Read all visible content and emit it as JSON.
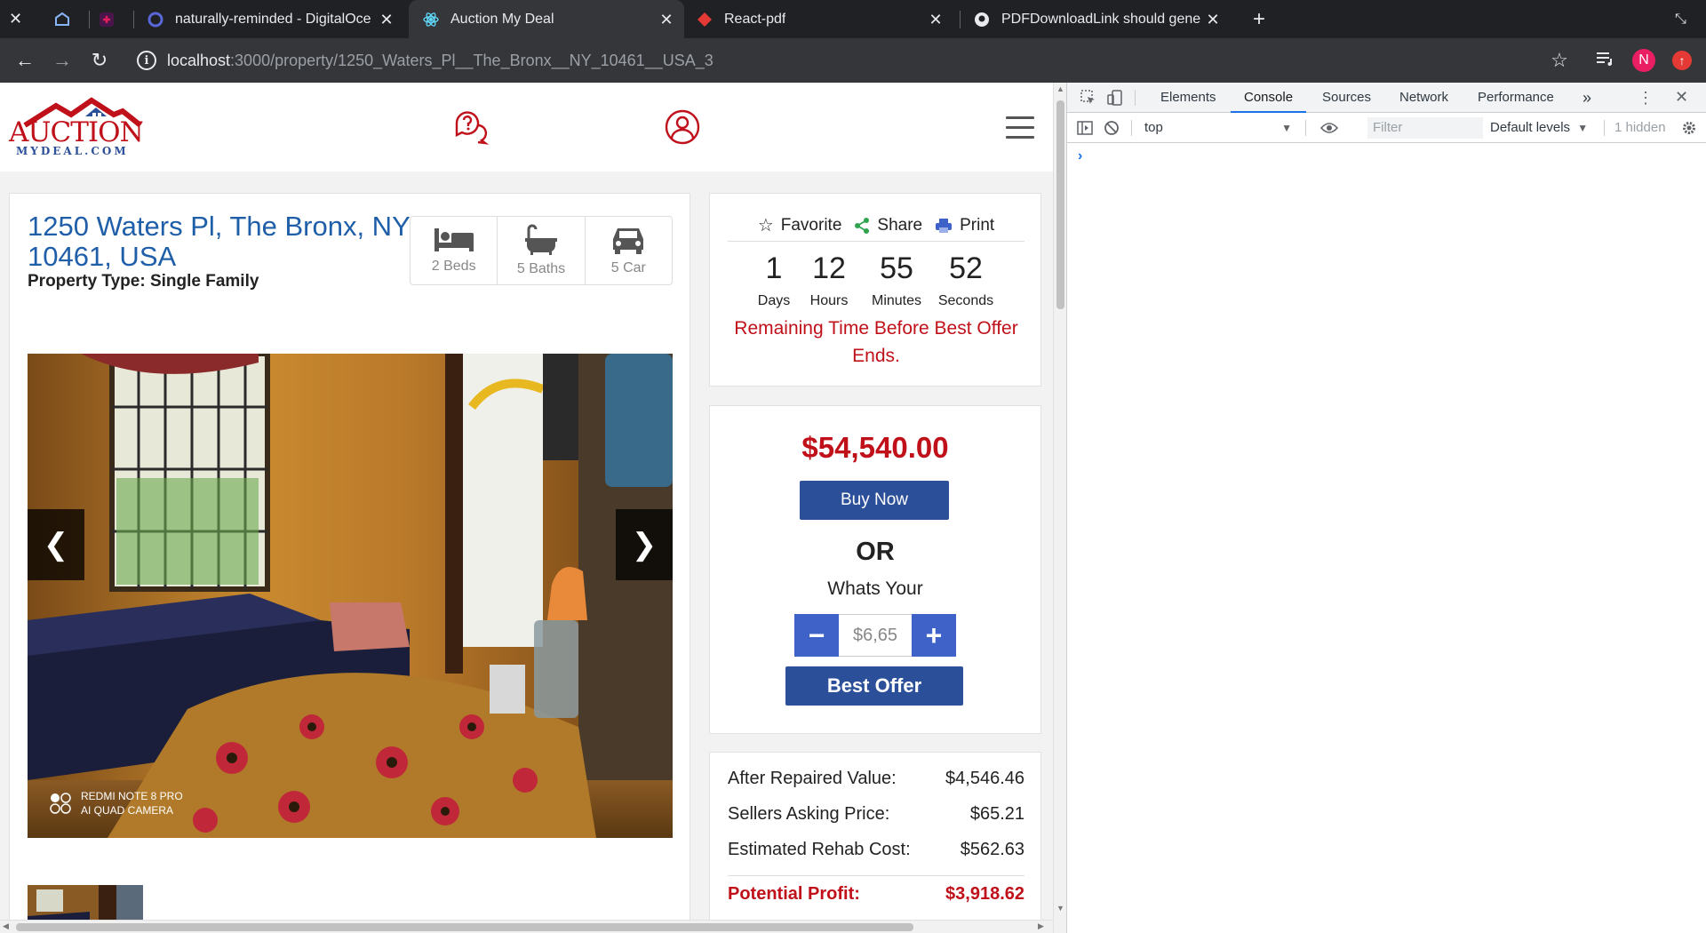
{
  "browser": {
    "tabs": [
      {
        "title": "",
        "icon": "close-icon"
      },
      {
        "title": "",
        "icon": "app-icon"
      },
      {
        "title": "",
        "icon": "slack-icon"
      },
      {
        "title": "naturally-reminded - DigitalOce",
        "icon": "digitalocean-icon"
      },
      {
        "title": "Auction My Deal",
        "icon": "react-icon",
        "active": true
      },
      {
        "title": "React-pdf",
        "icon": "react-pdf-icon"
      },
      {
        "title": "PDFDownloadLink should gene",
        "icon": "github-icon"
      }
    ],
    "url_host": "localhost",
    "url_path": ":3000/property/1250_Waters_Pl__The_Bronx__NY_10461__USA_3",
    "profile_initial": "N"
  },
  "site": {
    "logo_text": "AUCTION",
    "logo_sub": "MYDEAL.COM"
  },
  "property": {
    "address": "1250 Waters Pl, The Bronx, NY 10461, USA",
    "type": "Property Type: Single Family",
    "features": [
      {
        "icon": "bed-icon",
        "label": "2 Beds"
      },
      {
        "icon": "bath-icon",
        "label": "5 Baths"
      },
      {
        "icon": "car-icon",
        "label": "5 Car"
      }
    ],
    "watermark_line1": "REDMI NOTE 8 PRO",
    "watermark_line2": "AI QUAD CAMERA"
  },
  "actions": {
    "favorite": "Favorite",
    "share": "Share",
    "print": "Print"
  },
  "countdown": {
    "days": "1",
    "days_label": "Days",
    "hours": "12",
    "hours_label": "Hours",
    "minutes": "55",
    "minutes_label": "Minutes",
    "seconds": "52",
    "seconds_label": "Seconds",
    "message": "Remaining Time Before Best Offer Ends."
  },
  "offer": {
    "price": "$54,540.00",
    "buy_now": "Buy Now",
    "or": "OR",
    "whats_your": "Whats Your",
    "offer_value": "$6,65",
    "minus": "−",
    "plus": "+",
    "best_offer": "Best Offer"
  },
  "values": {
    "arv_label": "After Repaired Value:",
    "arv": "$4,546.46",
    "asking_label": "Sellers Asking Price:",
    "asking": "$65.21",
    "rehab_label": "Estimated Rehab Cost:",
    "rehab": "$562.63",
    "profit_label": "Potential Profit:",
    "profit": "$3,918.62"
  },
  "devtools": {
    "tabs": [
      "Elements",
      "Console",
      "Sources",
      "Network",
      "Performance"
    ],
    "active_tab": "Console",
    "more": "»",
    "context": "top",
    "filter_placeholder": "Filter",
    "levels": "Default levels",
    "hidden": "1 hidden",
    "prompt": "›"
  },
  "colors": {
    "brand_red": "#c0101a",
    "brand_blue": "#2c4f99",
    "address_blue": "#1f5ea8"
  }
}
